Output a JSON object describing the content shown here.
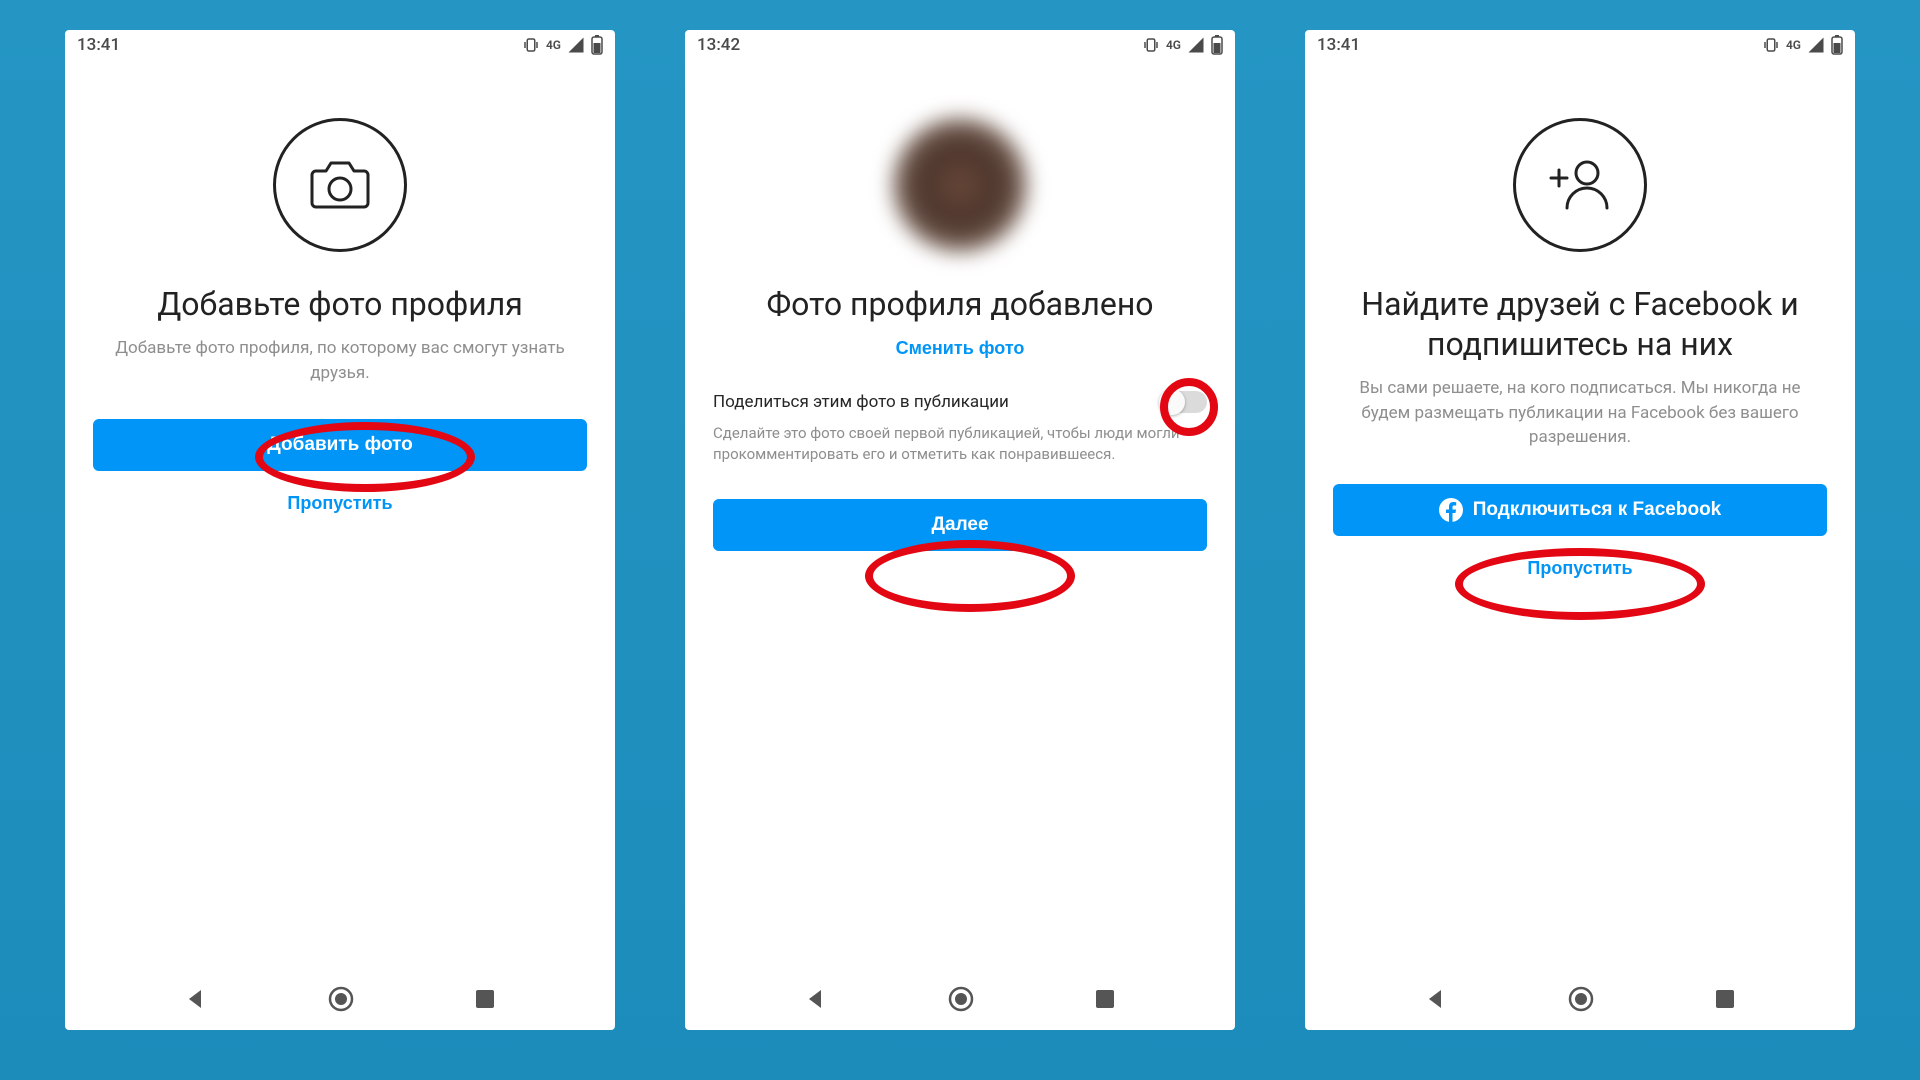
{
  "screens": [
    {
      "time": "13:41",
      "network": "4G",
      "title": "Добавьте фото профиля",
      "subtitle": "Добавьте фото профиля, по которому вас смогут узнать друзья.",
      "primary_button": "Добавить фото",
      "skip_button": "Пропустить"
    },
    {
      "time": "13:42",
      "network": "4G",
      "title": "Фото профиля добавлено",
      "change_photo_link": "Сменить фото",
      "share_label": "Поделиться этим фото в публикации",
      "share_desc": "Сделайте это фото своей первой публикацией, чтобы люди могли прокомментировать его и отметить как понравившееся.",
      "primary_button": "Далее"
    },
    {
      "time": "13:41",
      "network": "4G",
      "title": "Найдите друзей с Facebook и подпишитесь на них",
      "subtitle": "Вы сами решаете, на кого подписаться. Мы никогда не будем размещать публикации на Facebook без вашего разрешения.",
      "primary_button": "Подключиться к Facebook",
      "skip_button": "Пропустить"
    }
  ]
}
